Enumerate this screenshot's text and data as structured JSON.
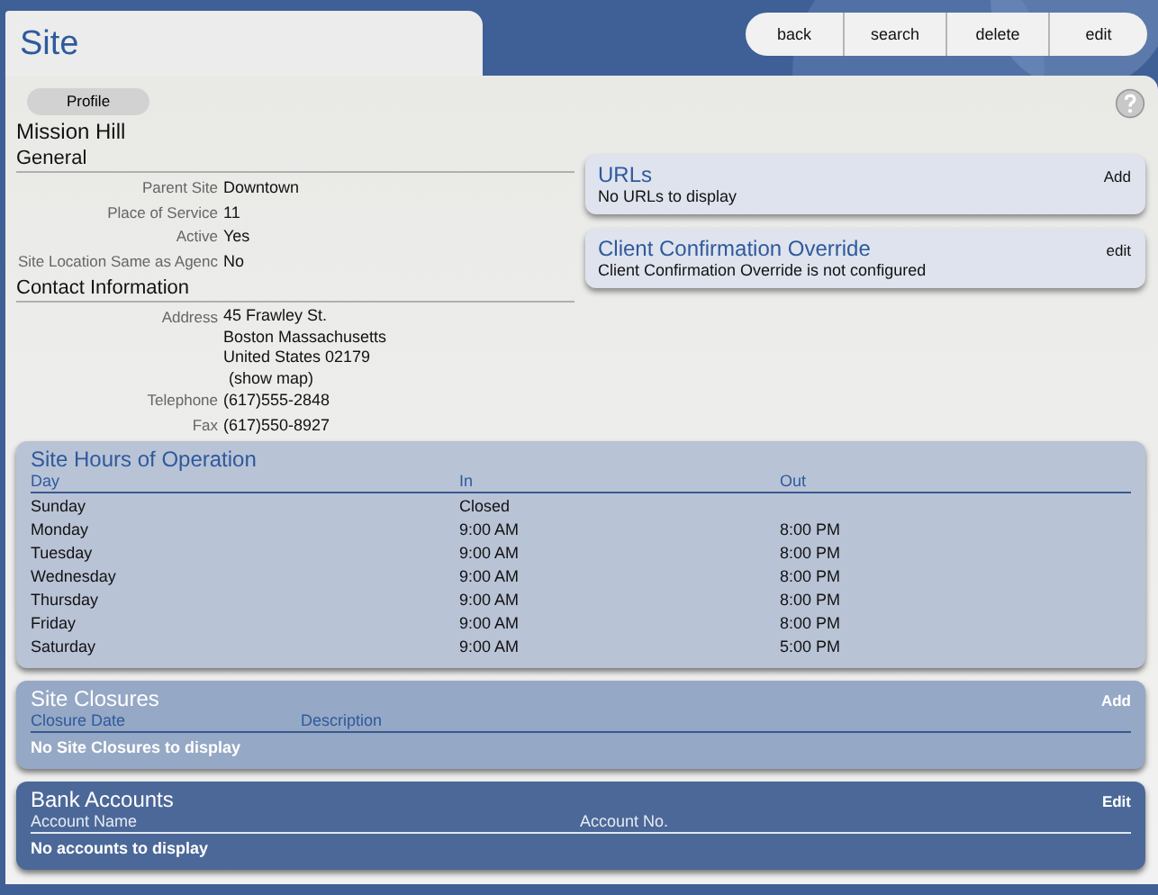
{
  "page_title": "Site",
  "toolbar": [
    "back",
    "search",
    "delete",
    "edit"
  ],
  "profile_tab": "Profile",
  "record_name": "Mission Hill",
  "general": {
    "heading": "General",
    "fields": [
      {
        "label": "Parent Site",
        "value": "Downtown"
      },
      {
        "label": "Place of Service",
        "value": "11"
      },
      {
        "label": "Active",
        "value": "Yes"
      },
      {
        "label": "Site Location Same as Agenc",
        "value": "No"
      }
    ]
  },
  "contact": {
    "heading": "Contact Information",
    "address_label": "Address",
    "address_lines": [
      "45 Frawley St.",
      "Boston Massachusetts",
      "United States 02179"
    ],
    "map_link": "(show map)",
    "fields": [
      {
        "label": "Telephone",
        "value": "(617)555-2848"
      },
      {
        "label": "Fax",
        "value": "(617)550-8927"
      }
    ]
  },
  "side_panels": [
    {
      "title": "URLs",
      "action": "Add",
      "message": "No URLs to display"
    },
    {
      "title": "Client Confirmation Override",
      "action": "edit",
      "message": "Client Confirmation Override is not configured"
    }
  ],
  "tables": [
    {
      "kind": "light",
      "title": "Site Hours of Operation",
      "columns": [
        "Day",
        "In",
        "Out"
      ],
      "rows": [
        [
          "Sunday",
          "Closed",
          ""
        ],
        [
          "Monday",
          "9:00 AM",
          "8:00 PM"
        ],
        [
          "Tuesday",
          "9:00 AM",
          "8:00 PM"
        ],
        [
          "Wednesday",
          "9:00 AM",
          "8:00 PM"
        ],
        [
          "Thursday",
          "9:00 AM",
          "8:00 PM"
        ],
        [
          "Friday",
          "9:00 AM",
          "8:00 PM"
        ],
        [
          "Saturday",
          "9:00 AM",
          "5:00 PM"
        ]
      ]
    },
    {
      "kind": "medium",
      "title": "Site Closures",
      "action": "Add",
      "columns": [
        "Closure Date",
        "Description"
      ],
      "empty_message": "No Site Closures to display"
    },
    {
      "kind": "dark",
      "title": "Bank Accounts",
      "action": "Edit",
      "columns": [
        "Account Name",
        "Account No."
      ],
      "empty_message": "No accounts to display"
    }
  ]
}
